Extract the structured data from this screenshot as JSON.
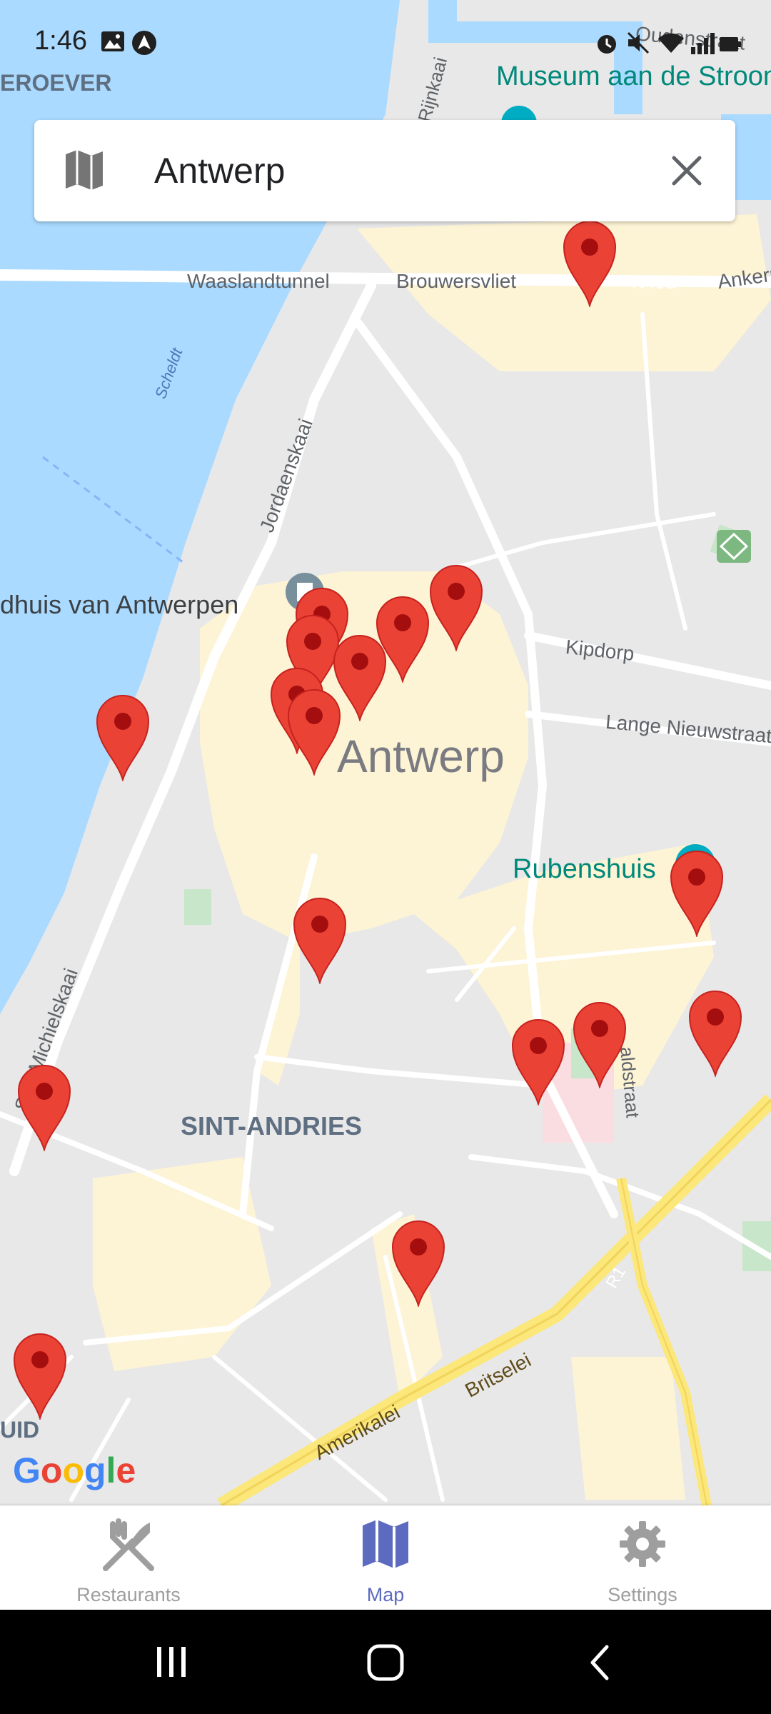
{
  "status_bar": {
    "time": "1:46"
  },
  "search": {
    "query": "Antwerp"
  },
  "map": {
    "labels": {
      "linkeroever": "EROEVER",
      "museum": "Museum aan de Stroom",
      "oudenstraat": "Oudenstraat",
      "waaslandtunnel": "Waaslandtunnel",
      "brouwersvliet": "Brouwersvliet",
      "n49a": "N49a",
      "anker": "Ankerrui",
      "scheldt": "Scheldt",
      "jordaenskaai": "Jordaenskaai",
      "kaai": "Rijnkaai",
      "stadhuis": "dhuis van Antwerpen",
      "kipdorp": "Kipdorp",
      "lange": "Lange Nieuwstraat",
      "city": "Antwerp",
      "rubenshuis": "Rubenshuis",
      "michielskaai": "Sint-Michielskaai",
      "sintandries": "SINT-ANDRIES",
      "aldstraat": "aldstraat",
      "amerikalei": "Amerikalei",
      "britselei": "Britselei",
      "r1": "R1",
      "zuid": "UID"
    },
    "attribution": "Google",
    "accent_colors": {
      "water": "#aadaff",
      "pin": "#ea4335",
      "poi": "#00897b"
    }
  },
  "bottom_nav": {
    "tabs": [
      {
        "label": "Restaurants",
        "icon": "fork-knife-icon",
        "selected": false
      },
      {
        "label": "Map",
        "icon": "map-icon",
        "selected": true
      },
      {
        "label": "Settings",
        "icon": "gear-icon",
        "selected": false
      }
    ],
    "selected_color": "#5c6bc0",
    "unselected_color": "#9e9e9e"
  }
}
